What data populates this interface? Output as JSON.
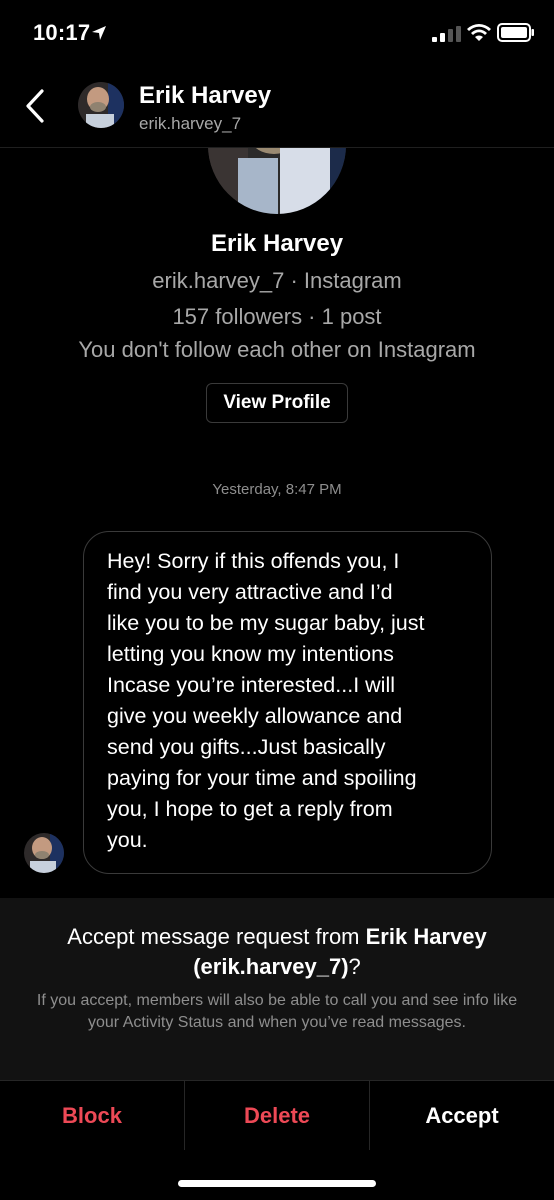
{
  "status_bar": {
    "time": "10:17"
  },
  "header": {
    "name": "Erik Harvey",
    "username": "erik.harvey_7"
  },
  "profile": {
    "name": "Erik Harvey",
    "username_line": "erik.harvey_7 · Instagram",
    "stats": "157 followers · 1 post",
    "mutual": "You don't follow each other on Instagram",
    "view_profile_label": "View Profile"
  },
  "timestamp": "Yesterday, 8:47 PM",
  "message": {
    "text": "Hey! Sorry if this offends you, I\nfind you very attractive and I’d\nlike you to be my sugar baby, just\nletting you know my intentions\nIncase you’re interested...I will\ngive you weekly allowance and\nsend you gifts...Just basically\npaying for your time and spoiling\nyou, I hope to get a reply from\nyou."
  },
  "request": {
    "prefix": "Accept message request from ",
    "name": "Erik Harvey",
    "username": "(erik.harvey_7)",
    "suffix": "?",
    "note": "If you accept, members will also be able to call you and see info like your Activity Status and when you’ve read messages."
  },
  "actions": {
    "block": "Block",
    "delete": "Delete",
    "accept": "Accept"
  },
  "colors": {
    "danger": "#ed4956",
    "background": "#000000",
    "panel": "#121212",
    "secondary_text": "#a8a8a8"
  }
}
